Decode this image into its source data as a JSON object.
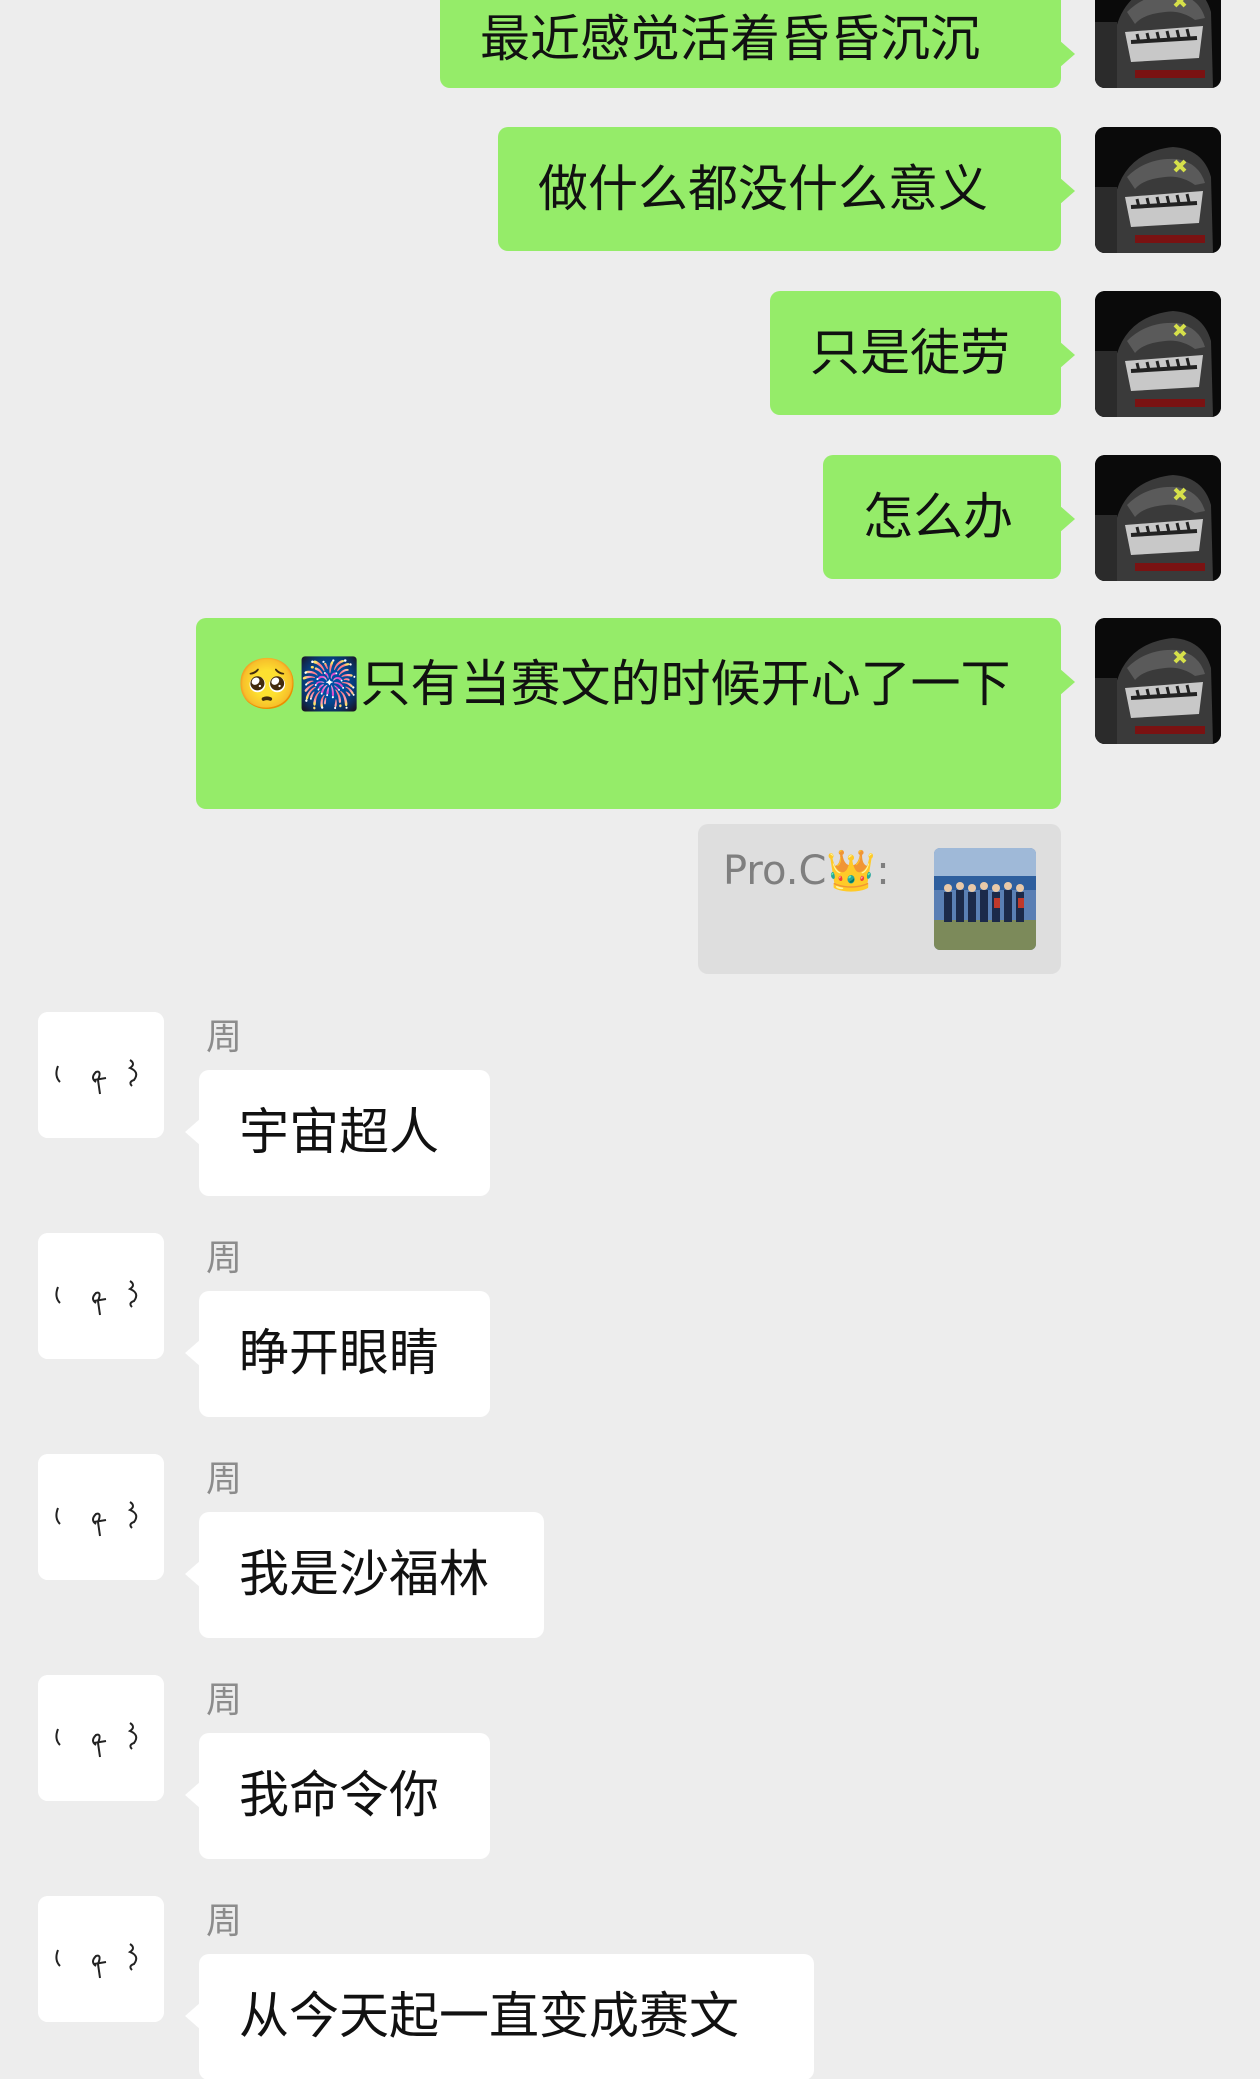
{
  "outgoing": [
    {
      "text": "最近感觉活着昏昏沉沉"
    },
    {
      "text": "做什么都没什么意义"
    },
    {
      "text": "只是徒劳"
    },
    {
      "text": "怎么办"
    },
    {
      "emoji": "🥺🎆",
      "text": "只有当赛文的时候开心了一下"
    }
  ],
  "quote": {
    "text": "Pro.C👑:"
  },
  "sender": {
    "name": "周"
  },
  "incoming": [
    {
      "text": "宇宙超人"
    },
    {
      "text": "睁开眼睛"
    },
    {
      "text": "我是沙福林"
    },
    {
      "text": "我命令你"
    },
    {
      "text": "从今天起一直变成赛文"
    }
  ],
  "colors": {
    "background": "#ededed",
    "outgoing_bubble": "#95ec69",
    "incoming_bubble": "#ffffff",
    "quote_bg": "#dedede",
    "name_text": "#8c8c8c"
  },
  "icons": {
    "self_avatar": "shark-avatar-icon",
    "sender_avatar": "handwriting-avatar-icon"
  }
}
